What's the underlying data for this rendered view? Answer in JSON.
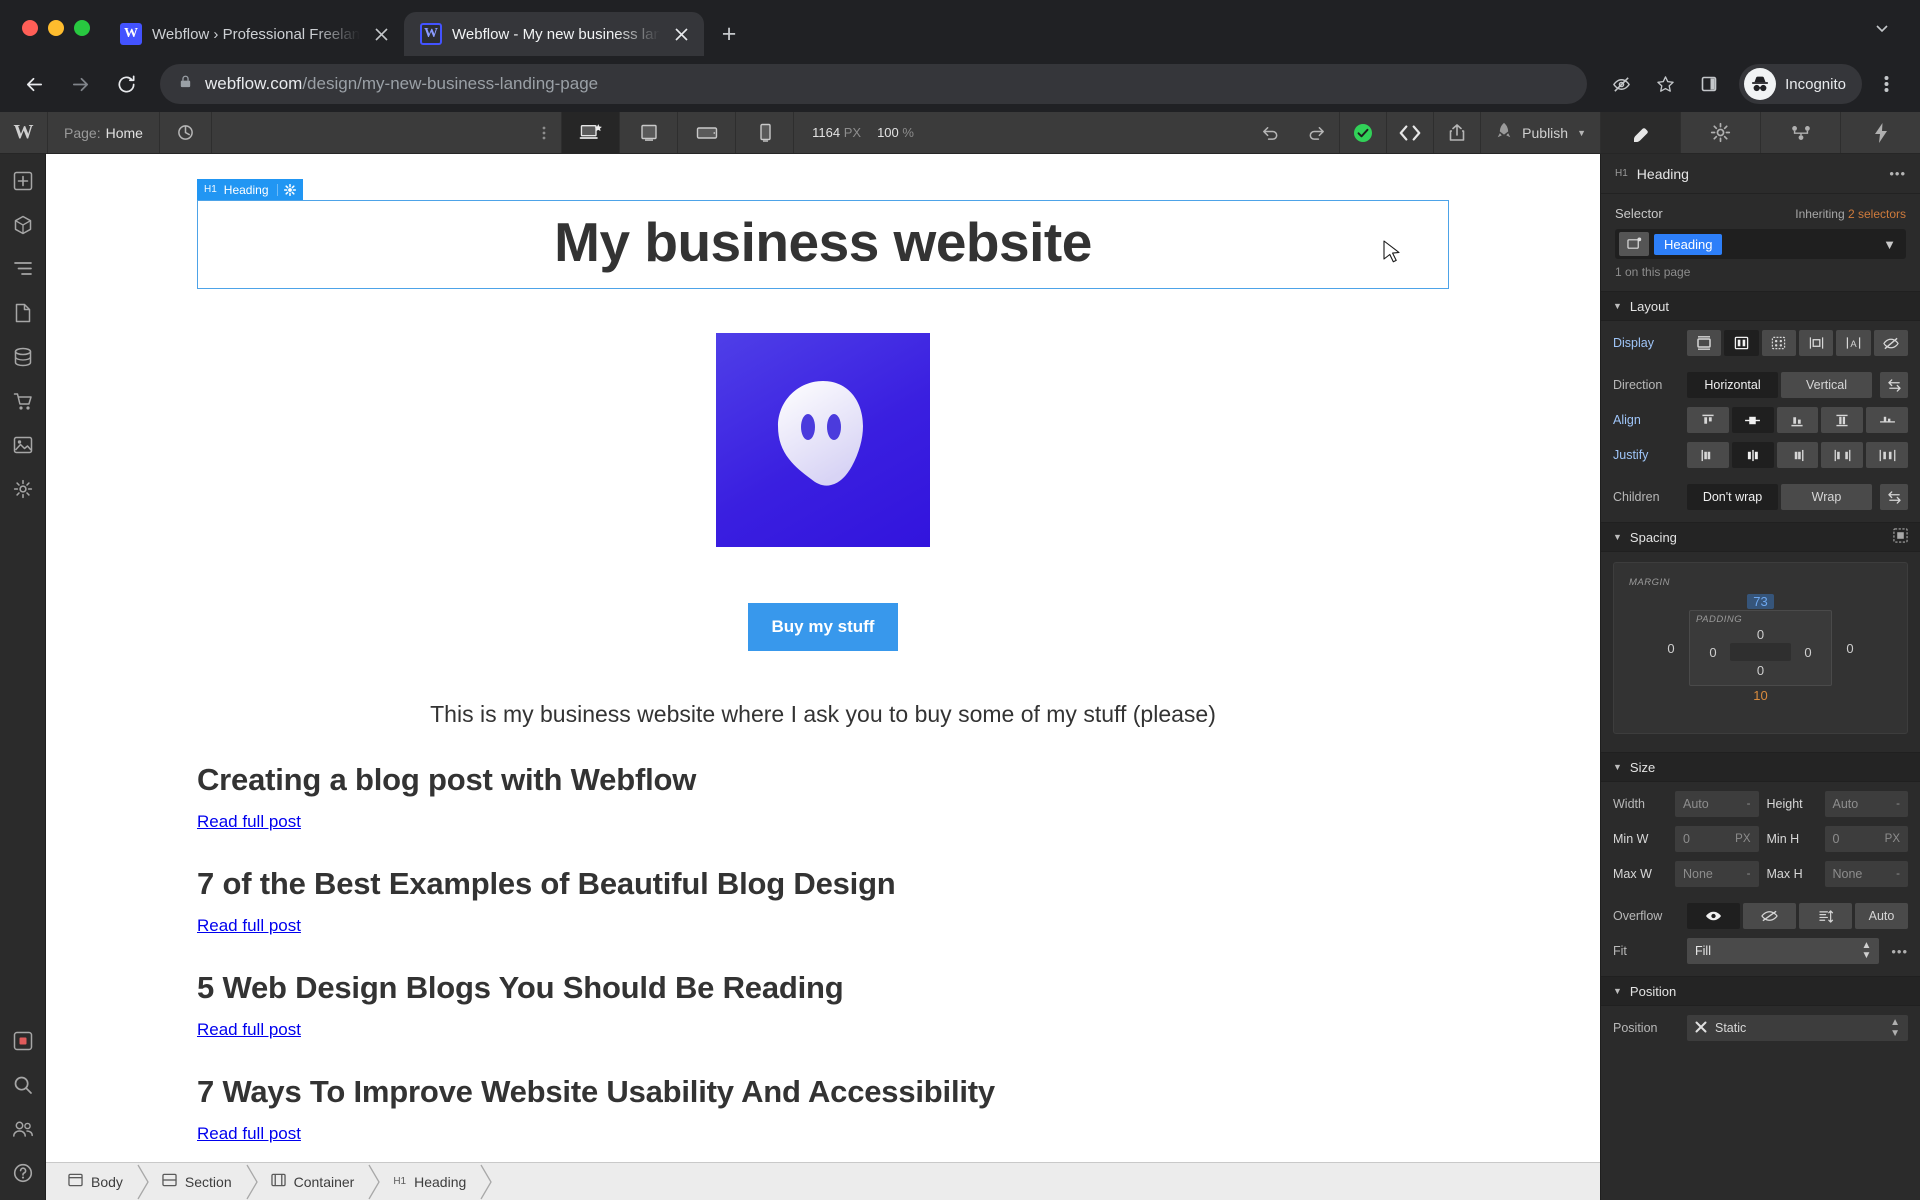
{
  "browser": {
    "tabs": [
      {
        "title": "Webflow › Professional Freelan",
        "favicon": "webflow-favicon",
        "active": false
      },
      {
        "title": "Webflow - My new business lan",
        "favicon": "webflow-favicon",
        "active": true
      }
    ],
    "new_tab_label": "+",
    "url_domain": "webflow.com",
    "url_path": "/design/my-new-business-landing-page",
    "profile_label": "Incognito",
    "icons": {
      "back": "back-arrow-icon",
      "forward": "forward-arrow-icon",
      "reload": "reload-icon",
      "lock": "lock-icon",
      "tracking": "eye-off-icon",
      "bookmark": "star-icon",
      "sidepanel": "side-panel-icon",
      "menu": "three-dot-menu-icon",
      "tabsearch": "chevron-down-icon"
    }
  },
  "designer": {
    "logo": "W",
    "page_label": "Page:",
    "page_value": "Home",
    "devices": [
      {
        "name": "desktop",
        "selected": true
      },
      {
        "name": "tablet",
        "selected": false
      },
      {
        "name": "mobile-landscape",
        "selected": false
      },
      {
        "name": "mobile-portrait",
        "selected": false
      }
    ],
    "canvas_width": "1164",
    "canvas_width_unit": "PX",
    "zoom_value": "100",
    "zoom_unit": "%",
    "actions": [
      "undo-icon",
      "redo-icon",
      "saved-check-icon",
      "code-icon",
      "share-icon"
    ],
    "publish_label": "Publish",
    "right_icons": [
      "style-panel-icon",
      "settings-gear-icon",
      "interactions-icon",
      "flash-icon"
    ],
    "rail_icons": [
      "add-elements-icon",
      "components-icon",
      "pages-icon",
      "navigator-icon",
      "cms-collections-icon",
      "ecommerce-icon",
      "assets-icon",
      "settings-icon"
    ],
    "rail_bottom_icons": [
      "video-tutorials-icon",
      "search-icon",
      "team-icon",
      "help-icon"
    ]
  },
  "canvas": {
    "label_tag": {
      "sup": "H1",
      "name": "Heading",
      "gear": "gear-icon"
    },
    "heading": "My business website",
    "image_alt": "ghost-logo",
    "button_label": "Buy my stuff",
    "lede": "This is my business website where I ask you to buy some of my stuff (please)",
    "posts": [
      {
        "title": "Creating a blog post with Webflow",
        "link": "Read full post"
      },
      {
        "title": "7 of the Best Examples of Beautiful Blog Design",
        "link": "Read full post"
      },
      {
        "title": "5 Web Design Blogs You Should Be Reading",
        "link": "Read full post"
      },
      {
        "title": "7 Ways To Improve Website Usability And Accessibility",
        "link": "Read full post"
      }
    ]
  },
  "breadcrumbs": [
    {
      "icon": "body-icon",
      "sup": "",
      "label": "Body"
    },
    {
      "icon": "section-icon",
      "sup": "",
      "label": "Section"
    },
    {
      "icon": "container-icon",
      "sup": "",
      "label": "Container"
    },
    {
      "icon": "",
      "sup": "H1",
      "label": "Heading"
    }
  ],
  "panel": {
    "header": {
      "sup": "H1",
      "title": "Heading",
      "menu": "•••"
    },
    "selector": {
      "label": "Selector",
      "inheriting_prefix": "Inheriting ",
      "inheriting_value": "2 selectors",
      "chip": "Heading",
      "count": "1 on this page"
    },
    "layout": {
      "title": "Layout",
      "display_label": "Display",
      "display_options": [
        "block",
        "flex",
        "grid",
        "inline-block",
        "inline",
        "none"
      ],
      "display_selected_index": 1,
      "direction_label": "Direction",
      "direction_options": [
        "Horizontal",
        "Vertical"
      ],
      "direction_selected_index": 0,
      "align_label": "Align",
      "align_selected_index": 1,
      "justify_label": "Justify",
      "justify_selected_index": 1,
      "children_label": "Children",
      "children_options": [
        "Don't wrap",
        "Wrap"
      ],
      "children_selected_index": 0
    },
    "spacing": {
      "title": "Spacing",
      "margin_caption": "MARGIN",
      "padding_caption": "PADDING",
      "margin_top": "73",
      "margin_bottom": "10",
      "margin_left": "0",
      "margin_right": "0",
      "padding_top": "0",
      "padding_bottom": "0",
      "padding_left": "0",
      "padding_right": "0"
    },
    "size": {
      "title": "Size",
      "width_label": "Width",
      "width_value": "Auto",
      "height_label": "Height",
      "height_value": "Auto",
      "minw_label": "Min W",
      "minw_value": "0",
      "minw_unit": "PX",
      "minh_label": "Min H",
      "minh_value": "0",
      "minh_unit": "PX",
      "maxw_label": "Max W",
      "maxw_value": "None",
      "maxh_label": "Max H",
      "maxh_value": "None",
      "overflow_label": "Overflow",
      "overflow_options": [
        "visible",
        "hidden",
        "scroll",
        "Auto"
      ],
      "overflow_selected_index": 0,
      "overflow_auto_label": "Auto",
      "fit_label": "Fit",
      "fit_value": "Fill"
    },
    "position": {
      "title": "Position",
      "position_label": "Position",
      "position_value": "Static"
    }
  },
  "colors": {
    "accent_blue": "#2d7ff9",
    "canvas_outline": "#4da3e8",
    "button_blue": "#3898ec",
    "link_blue": "#0000ee",
    "orange": "#cf7b3c",
    "green_check": "#31d158",
    "webflow_blue": "#4353ff",
    "ghost_purple": "#3a1fe0"
  }
}
